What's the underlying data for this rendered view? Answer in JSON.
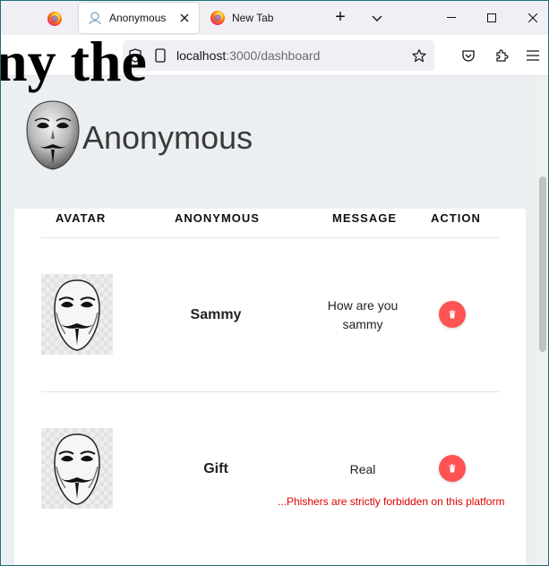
{
  "browser": {
    "tabs": [
      {
        "label": "Anonymous",
        "active": true
      },
      {
        "label": "New Tab",
        "active": false
      }
    ],
    "url": {
      "host": "localhost",
      "rest": ":3000/dashboard"
    }
  },
  "page": {
    "overflow_heading": "ny the",
    "brand_title": "Anonymous",
    "table": {
      "headers": [
        "AVATAR",
        "ANONYMOUS",
        "MESSAGE",
        "ACTION"
      ],
      "rows": [
        {
          "name": "Sammy",
          "message": "How are you sammy"
        },
        {
          "name": "Gift",
          "message": "Real"
        }
      ]
    },
    "warning": "...Phishers are strictly forbidden on this platform"
  },
  "colors": {
    "delete_button": "#ff5252",
    "warning_text": "#e00000"
  }
}
